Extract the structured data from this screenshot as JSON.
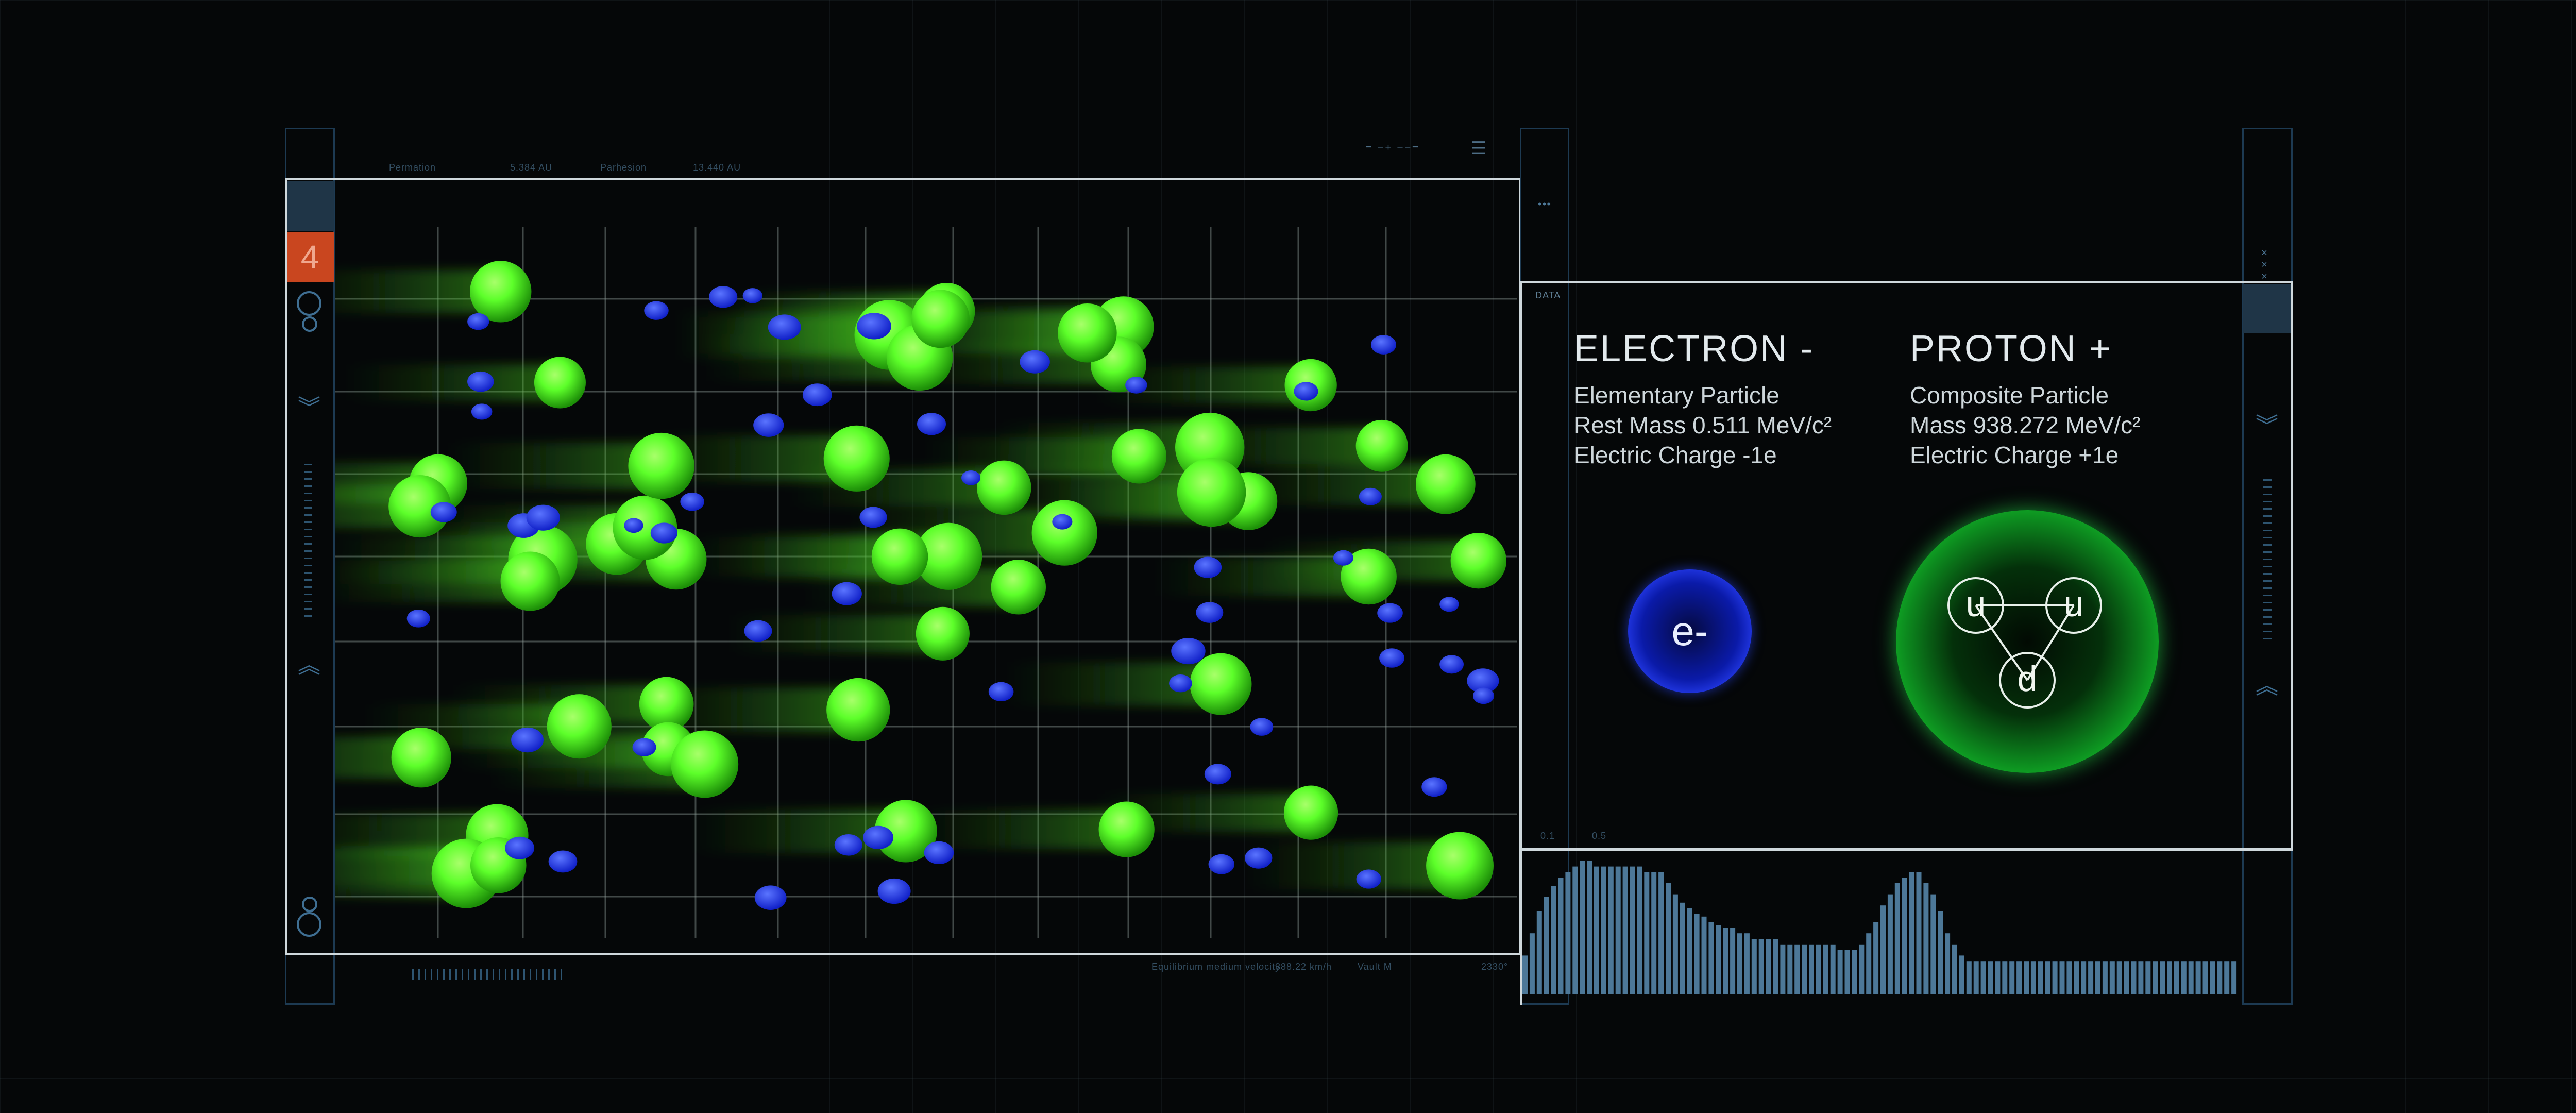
{
  "sim_panel": {
    "header_left_1": "Permation",
    "header_left_2": "5.384 AU",
    "header_left_3": "Parhesion",
    "header_left_4": "13.440 AU",
    "header_right_1": "⁼ ⁻⁺ ⁻⁻⁼",
    "header_right_2": "☰",
    "footer_1": "Equilibrium medium velocity",
    "footer_2": "388.22 km/h",
    "footer_3": "Vault M",
    "footer_4": "2330°",
    "tab_number": "4"
  },
  "left_rail": {
    "icons": [
      "target-icon",
      "chevron-double-down-icon",
      "chevron-double-up-icon",
      "target-icon"
    ]
  },
  "data_panel": {
    "label": "DATA",
    "menu_dots": "•••",
    "right_menu": "×××",
    "scale_1": "0.1",
    "scale_2": "0.5",
    "electron": {
      "title": "ELECTRON -",
      "line1": "Elementary Particle",
      "line2": "Rest Mass  0.511  MeV/c²",
      "line3": "Electric Charge -1e",
      "symbol": "e-"
    },
    "proton": {
      "title": "PROTON +",
      "line1": "Composite Particle",
      "line2": "Mass  938.272  MeV/c²",
      "line3": "Electric Charge +1e",
      "quarks": [
        "u",
        "u",
        "d"
      ]
    }
  },
  "histogram": {
    "values": [
      28,
      44,
      60,
      70,
      78,
      84,
      88,
      92,
      96,
      96,
      92,
      92,
      92,
      92,
      92,
      92,
      92,
      88,
      88,
      88,
      80,
      72,
      66,
      62,
      58,
      56,
      52,
      50,
      48,
      48,
      44,
      44,
      40,
      40,
      40,
      40,
      36,
      36,
      36,
      36,
      36,
      36,
      36,
      36,
      32,
      32,
      32,
      36,
      44,
      52,
      64,
      72,
      80,
      84,
      88,
      88,
      80,
      72,
      60,
      44,
      36,
      28,
      24,
      24,
      24,
      24,
      24,
      24,
      24,
      24,
      24,
      24,
      24,
      24,
      24,
      24,
      24,
      24,
      24,
      24,
      24,
      24,
      24,
      24,
      24,
      24,
      24,
      24,
      24,
      24,
      24,
      24,
      24,
      24,
      24,
      24,
      24,
      24,
      24,
      24
    ],
    "color": "#4d7898"
  },
  "colors": {
    "accent_green": "#5dff2a",
    "accent_blue": "#1f3cff",
    "tab_orange": "#c9461f",
    "rail": "#1d3a52"
  }
}
